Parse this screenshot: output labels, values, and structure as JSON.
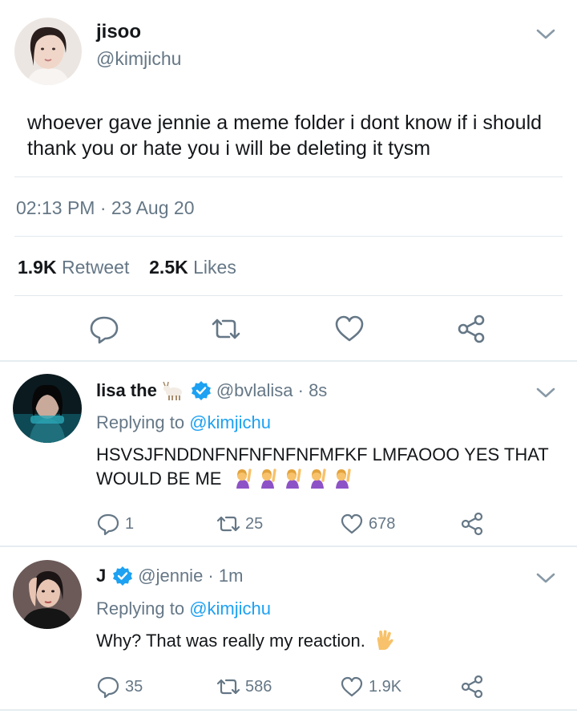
{
  "main": {
    "name": "jisoo",
    "handle": "@kimjichu",
    "text": "whoever gave jennie a meme folder i dont know if i should thank you or hate you i will be deleting it tysm",
    "timestamp": "02:13 PM · 23 Aug 20",
    "retweets_count": "1.9K",
    "retweets_label": "Retweet",
    "likes_count": "2.5K",
    "likes_label": "Likes"
  },
  "replies": [
    {
      "name": "lisa the",
      "name_emoji": "goat",
      "handle_time": "@bvlalisa · 8s",
      "replying_prefix": "Replying to",
      "replying_to": "@kimjichu",
      "text": "HSVSJFNDDNFNFNFNFNFMFKF LMFAOOO YES THAT WOULD BE ME",
      "text_emoji": "woman-raising-hand x5",
      "reply_count": "1",
      "retweet_count": "25",
      "like_count": "678"
    },
    {
      "name": "J",
      "handle_time": "@jennie · 1m",
      "replying_prefix": "Replying to",
      "replying_to": "@kimjichu",
      "text": "Why? That was really my reaction.",
      "text_emoji": "vulcan-salute",
      "reply_count": "35",
      "retweet_count": "586",
      "like_count": "1.9K"
    }
  ],
  "colors": {
    "text": "#14171a",
    "secondary": "#657786",
    "link": "#1da1f2",
    "divider": "#e1e8ed",
    "icon": "#657786"
  },
  "icons": [
    "chevron-down-icon",
    "reply-icon",
    "retweet-icon",
    "like-icon",
    "share-icon",
    "verified-icon"
  ]
}
